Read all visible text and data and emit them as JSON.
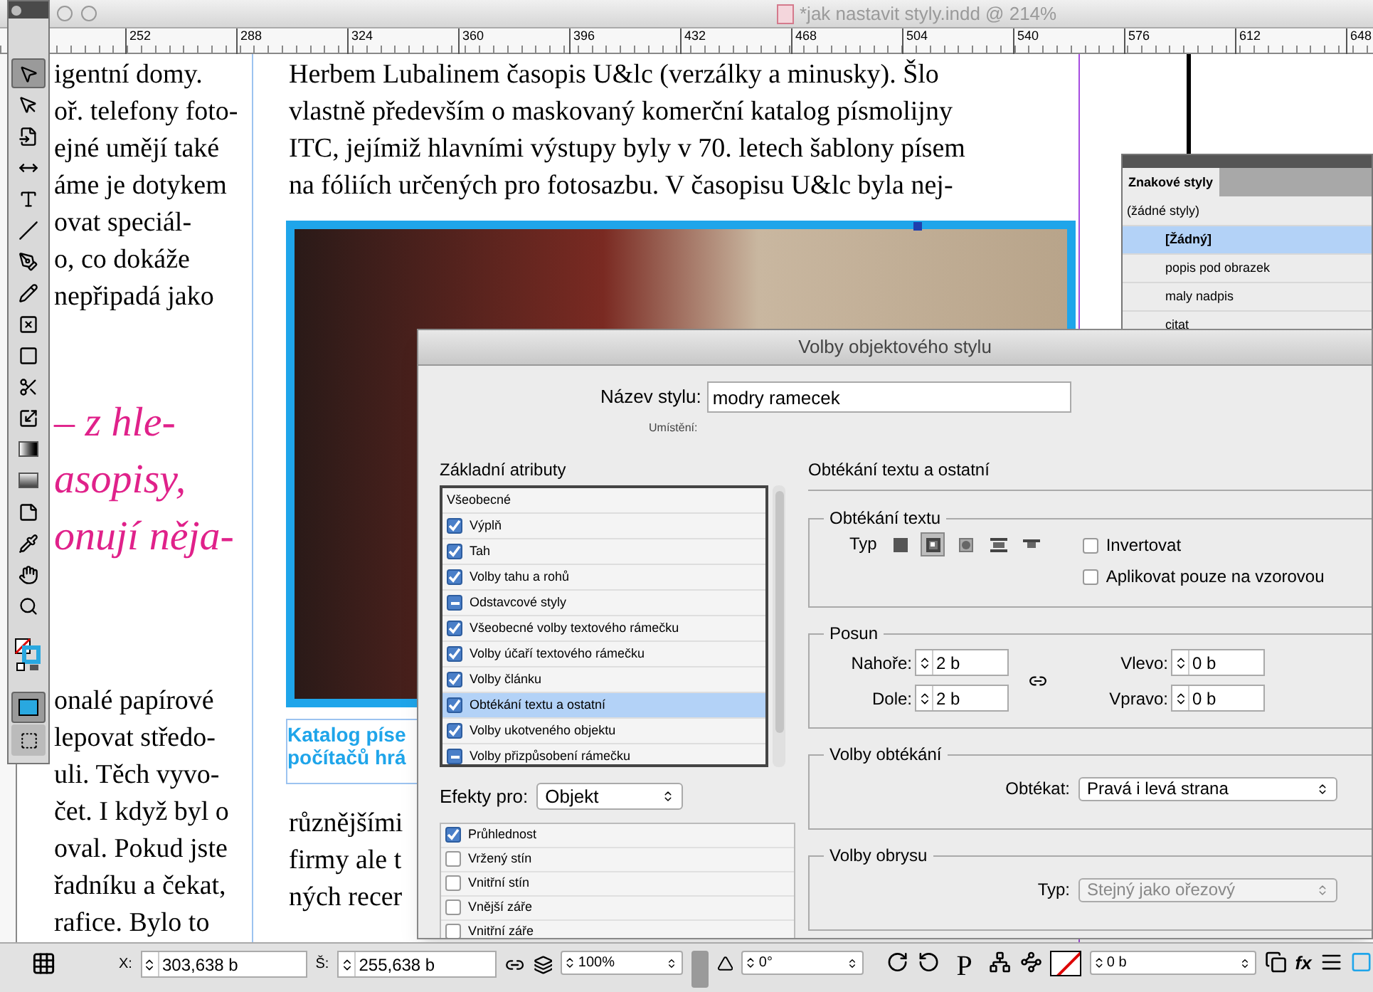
{
  "window": {
    "title": "*jak nastavit styly.indd @ 214%"
  },
  "ruler": {
    "labels": [
      "252",
      "288",
      "324",
      "360",
      "396",
      "432",
      "468",
      "504",
      "540",
      "576",
      "612",
      "648"
    ]
  },
  "tools": [
    {
      "kind": "selection",
      "selected": true
    },
    {
      "kind": "direct",
      "selected": false
    },
    {
      "kind": "page",
      "selected": false
    },
    {
      "kind": "gap",
      "selected": false
    },
    {
      "kind": "type",
      "selected": false
    },
    {
      "kind": "line",
      "selected": false
    },
    {
      "kind": "pen",
      "selected": false
    },
    {
      "kind": "pencil",
      "selected": false
    },
    {
      "kind": "frame",
      "selected": false
    },
    {
      "kind": "rectangle",
      "selected": false
    },
    {
      "kind": "scissors",
      "selected": false
    },
    {
      "kind": "transform",
      "selected": false
    },
    {
      "kind": "gradient",
      "selected": false
    },
    {
      "kind": "feather",
      "selected": false
    },
    {
      "kind": "note",
      "selected": false
    },
    {
      "kind": "eyedropper",
      "selected": false
    },
    {
      "kind": "hand",
      "selected": false
    },
    {
      "kind": "zoom",
      "selected": false
    },
    {
      "kind": "swatches",
      "selected": false
    },
    {
      "kind": "view",
      "selected": true
    },
    {
      "kind": "screen",
      "selected": false
    }
  ],
  "document": {
    "left_column": [
      {
        "kind": "body",
        "lines": [
          "igentní domy.",
          "oř. telefony foto-",
          "ejné umějí také",
          "áme je dotykem",
          "ovat speciál-",
          "o, co dokáže",
          "nepřipadá jako"
        ]
      },
      {
        "kind": "pull_quote",
        "lines": [
          "– z hle-",
          "asopisy,",
          "onují něja-"
        ]
      },
      {
        "kind": "body",
        "lines": [
          "onalé papírové",
          "lepovat středo-",
          "uli. Těch vyvo-",
          "čet. I když byl o",
          "oval. Pokud jste",
          "řadníku a čekat,",
          "rafice. Bylo to"
        ]
      }
    ],
    "middle_top": [
      "Herbem Lubalinem  časopis U&lc (verzálky a minusky). Šlo",
      "vlastně především o maskovaný komerční katalog písmolijny",
      "ITC, jejímiž hlavními výstupy byly v 70. letech šablony písem",
      "na fóliích určených pro fotosazbu. V časopisu U&lc byla nej-"
    ],
    "caption": [
      "Katalog píse",
      "počítačů hrá"
    ],
    "middle_bottom": [
      "různějšími",
      "firmy ale t",
      "ných recer"
    ]
  },
  "character_styles": {
    "tab": "Znakové styly",
    "group": "(žádné styly)",
    "items": [
      {
        "label": "[Žádný]",
        "selected": true
      },
      {
        "label": "popis pod obrazek",
        "selected": false
      },
      {
        "label": "maly nadpis",
        "selected": false
      },
      {
        "label": "citat",
        "selected": false
      }
    ]
  },
  "dialog": {
    "title": "Volby objektového stylu",
    "name_label": "Název stylu:",
    "name_value": "modry ramecek",
    "location_label": "Umístění:",
    "attributes_heading": "Základní atributy",
    "attributes": [
      {
        "kind": "header",
        "label": "Všeobecné",
        "selected": false
      },
      {
        "kind": "option",
        "label": "Výplň",
        "checked": true,
        "partial": false,
        "selected": false
      },
      {
        "kind": "option",
        "label": "Tah",
        "checked": true,
        "partial": false,
        "selected": false
      },
      {
        "kind": "option",
        "label": "Volby tahu a rohů",
        "checked": true,
        "partial": false,
        "selected": false
      },
      {
        "kind": "option",
        "label": "Odstavcové styly",
        "checked": true,
        "partial": true,
        "selected": false
      },
      {
        "kind": "option",
        "label": "Všeobecné volby textového rámečku",
        "checked": true,
        "partial": false,
        "selected": false
      },
      {
        "kind": "option",
        "label": "Volby účaří textového rámečku",
        "checked": true,
        "partial": false,
        "selected": false
      },
      {
        "kind": "option",
        "label": "Volby článku",
        "checked": true,
        "partial": false,
        "selected": false
      },
      {
        "kind": "option",
        "label": "Obtékání textu a ostatní",
        "checked": true,
        "partial": false,
        "selected": true
      },
      {
        "kind": "option",
        "label": "Volby ukotveného objektu",
        "checked": true,
        "partial": false,
        "selected": false
      },
      {
        "kind": "option",
        "label": "Volby přizpůsobení rámečku",
        "checked": true,
        "partial": true,
        "selected": false
      }
    ],
    "effects_label": "Efekty pro:",
    "effects_target": "Objekt",
    "effects": [
      {
        "label": "Průhlednost",
        "checked": true
      },
      {
        "label": "Vržený stín",
        "checked": false
      },
      {
        "label": "Vnitřní stín",
        "checked": false
      },
      {
        "label": "Vnější záře",
        "checked": false
      },
      {
        "label": "Vnitřní záře",
        "checked": false
      }
    ],
    "section_heading": "Obtékání textu a ostatní",
    "wrap": {
      "legend": "Obtékání textu",
      "type_label": "Typ",
      "types": [
        {
          "kind": "none",
          "selected": false
        },
        {
          "kind": "box",
          "selected": true
        },
        {
          "kind": "shape",
          "selected": false
        },
        {
          "kind": "jump",
          "selected": false
        },
        {
          "kind": "next",
          "selected": false
        }
      ],
      "options": [
        {
          "label": "Invertovat",
          "checked": false
        },
        {
          "label": "Aplikovat pouze na vzorovou",
          "checked": false
        }
      ]
    },
    "offset": {
      "legend": "Posun",
      "fields": [
        {
          "label": "Nahoře:",
          "value": "2 b"
        },
        {
          "label": "Dole:",
          "value": "2 b"
        },
        {
          "label": "Vlevo:",
          "value": "0 b"
        },
        {
          "label": "Vpravo:",
          "value": "0 b"
        }
      ]
    },
    "wrap_options": {
      "legend": "Volby obtékání",
      "label": "Obtékat:",
      "value": "Pravá i levá strana",
      "disabled": false
    },
    "contour": {
      "legend": "Volby obrysu",
      "label": "Typ:",
      "value": "Stejný jako ořezový",
      "disabled": true
    }
  },
  "control_bar": {
    "x_label": "X:",
    "x_value": "303,638 b",
    "w_label": "Š:",
    "w_value": "255,638 b",
    "scale_value": "100%",
    "angle_value": "0°",
    "frame_glyph": "P",
    "stroke_value": "0 b",
    "effects_glyph": "fx"
  }
}
